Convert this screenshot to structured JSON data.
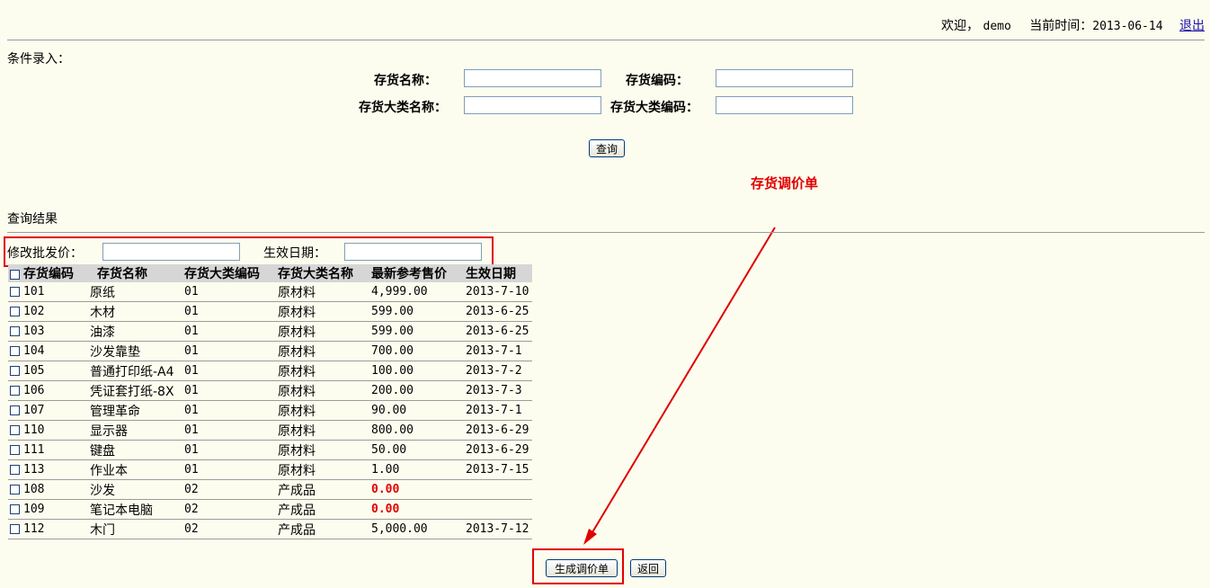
{
  "header": {
    "welcome": "欢迎，",
    "user": "demo",
    "time_label": "当前时间：",
    "date": "2013-06-14",
    "logout": "退出"
  },
  "criteria": {
    "title": "条件录入：",
    "name_label": "存货名称：",
    "code_label": "存货编码：",
    "cat_name_label": "存货大类名称：",
    "cat_code_label": "存货大类编码：",
    "query_button": "查询"
  },
  "annotation": {
    "text": "存货调价单",
    "color": "#e00000"
  },
  "results": {
    "title": "查询结果"
  },
  "edit": {
    "price_label": "修改批发价：",
    "date_label": "生效日期："
  },
  "table": {
    "columns": [
      "存货编码",
      "存货名称",
      "存货大类编码",
      "存货大类名称",
      "最新参考售价",
      "生效日期"
    ],
    "rows": [
      {
        "code": "101",
        "name": "原纸",
        "cat_code": "01",
        "cat_name": "原材料",
        "price": "4,999.00",
        "date": "2013-7-10",
        "highlight": false
      },
      {
        "code": "102",
        "name": "木材",
        "cat_code": "01",
        "cat_name": "原材料",
        "price": "599.00",
        "date": "2013-6-25",
        "highlight": false
      },
      {
        "code": "103",
        "name": "油漆",
        "cat_code": "01",
        "cat_name": "原材料",
        "price": "599.00",
        "date": "2013-6-25",
        "highlight": false
      },
      {
        "code": "104",
        "name": "沙发靠垫",
        "cat_code": "01",
        "cat_name": "原材料",
        "price": "700.00",
        "date": "2013-7-1",
        "highlight": false
      },
      {
        "code": "105",
        "name": "普通打印纸-A4",
        "cat_code": "01",
        "cat_name": "原材料",
        "price": "100.00",
        "date": "2013-7-2",
        "highlight": false
      },
      {
        "code": "106",
        "name": "凭证套打纸-8X",
        "cat_code": "01",
        "cat_name": "原材料",
        "price": "200.00",
        "date": "2013-7-3",
        "highlight": false
      },
      {
        "code": "107",
        "name": "管理革命",
        "cat_code": "01",
        "cat_name": "原材料",
        "price": "90.00",
        "date": "2013-7-1",
        "highlight": false
      },
      {
        "code": "110",
        "name": "显示器",
        "cat_code": "01",
        "cat_name": "原材料",
        "price": "800.00",
        "date": "2013-6-29",
        "highlight": false
      },
      {
        "code": "111",
        "name": "键盘",
        "cat_code": "01",
        "cat_name": "原材料",
        "price": "50.00",
        "date": "2013-6-29",
        "highlight": false
      },
      {
        "code": "113",
        "name": "作业本",
        "cat_code": "01",
        "cat_name": "原材料",
        "price": "1.00",
        "date": "2013-7-15",
        "highlight": false
      },
      {
        "code": "108",
        "name": "沙发",
        "cat_code": "02",
        "cat_name": "产成品",
        "price": "0.00",
        "date": "",
        "highlight": true
      },
      {
        "code": "109",
        "name": "笔记本电脑",
        "cat_code": "02",
        "cat_name": "产成品",
        "price": "0.00",
        "date": "",
        "highlight": true
      },
      {
        "code": "112",
        "name": "木门",
        "cat_code": "02",
        "cat_name": "产成品",
        "price": "5,000.00",
        "date": "2013-7-12",
        "highlight": false
      }
    ]
  },
  "actions": {
    "generate_button": "生成调价单",
    "back_button": "返回"
  }
}
